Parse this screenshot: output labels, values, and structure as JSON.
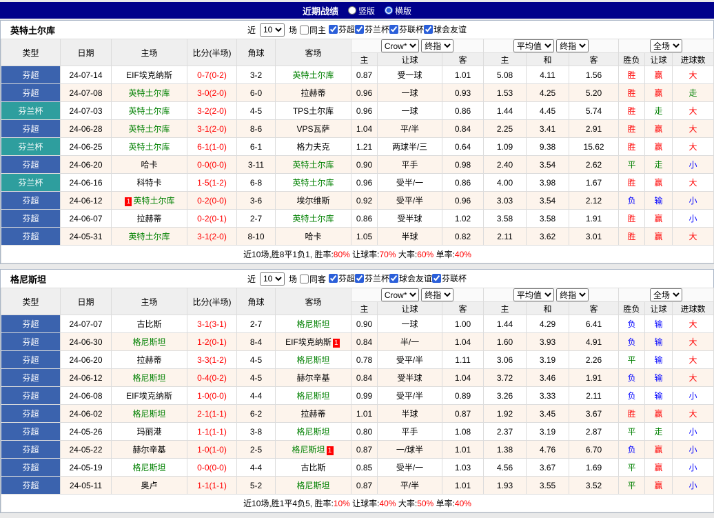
{
  "topbar": {
    "title": "近期战绩",
    "layout_options": [
      {
        "label": "竖版",
        "checked": false
      },
      {
        "label": "横版",
        "checked": true
      }
    ]
  },
  "colors": {
    "topbar_bg": "#00008b",
    "score": "#ff0000",
    "highlight_team": "#008000",
    "badge_bg": "#ff0000",
    "summary_value": "#ff0000",
    "league": {
      "芬超": "#3b63ae",
      "芬兰杯": "#2e9e9e"
    },
    "result": {
      "胜": "#ff0000",
      "平": "#008000",
      "负": "#0000ff",
      "赢": "#ff0000",
      "走": "#008000",
      "输": "#0000ff",
      "大": "#ff0000",
      "小": "#0000ff"
    }
  },
  "sections": [
    {
      "team": "英特土尔库",
      "filter": {
        "prefix": "近",
        "count": "10",
        "suffix": "场",
        "same": {
          "label": "同主",
          "checked": false
        },
        "leagues": [
          {
            "label": "芬超",
            "checked": true
          },
          {
            "label": "芬兰杯",
            "checked": true
          },
          {
            "label": "芬联杯",
            "checked": true
          },
          {
            "label": "球会友谊",
            "checked": true
          }
        ]
      },
      "selects": {
        "book": "Crow*",
        "book_stage": "终指",
        "avg": "平均值",
        "avg_stage": "终指",
        "scope": "全场"
      },
      "columns": {
        "type": "类型",
        "date": "日期",
        "home": "主场",
        "score": "比分(半场)",
        "corner": "角球",
        "away": "客场",
        "ah_home": "主",
        "ah_line": "让球",
        "ah_away": "客",
        "eu_home": "主",
        "eu_draw": "和",
        "eu_away": "客",
        "res_wdl": "胜负",
        "res_ah": "让球",
        "res_goal": "进球数"
      },
      "rows": [
        {
          "league": "芬超",
          "date": "24-07-14",
          "home": {
            "name": "EIF埃克纳斯",
            "hl": false
          },
          "score": "0-7(0-2)",
          "corner": "3-2",
          "away": {
            "name": "英特土尔库",
            "hl": true
          },
          "ah": [
            "0.87",
            "受一球",
            "1.01"
          ],
          "eu": [
            "5.08",
            "4.11",
            "1.56"
          ],
          "results": [
            "胜",
            "赢",
            "大"
          ]
        },
        {
          "league": "芬超",
          "date": "24-07-08",
          "home": {
            "name": "英特土尔库",
            "hl": true
          },
          "score": "3-0(2-0)",
          "corner": "6-0",
          "away": {
            "name": "拉赫蒂",
            "hl": false
          },
          "ah": [
            "0.96",
            "一球",
            "0.93"
          ],
          "eu": [
            "1.53",
            "4.25",
            "5.20"
          ],
          "results": [
            "胜",
            "赢",
            "走"
          ]
        },
        {
          "league": "芬兰杯",
          "date": "24-07-03",
          "home": {
            "name": "英特土尔库",
            "hl": true
          },
          "score": "3-2(2-0)",
          "corner": "4-5",
          "away": {
            "name": "TPS土尔库",
            "hl": false
          },
          "ah": [
            "0.96",
            "一球",
            "0.86"
          ],
          "eu": [
            "1.44",
            "4.45",
            "5.74"
          ],
          "results": [
            "胜",
            "走",
            "大"
          ]
        },
        {
          "league": "芬超",
          "date": "24-06-28",
          "home": {
            "name": "英特土尔库",
            "hl": true
          },
          "score": "3-1(2-0)",
          "corner": "8-6",
          "away": {
            "name": "VPS瓦萨",
            "hl": false
          },
          "ah": [
            "1.04",
            "平/半",
            "0.84"
          ],
          "eu": [
            "2.25",
            "3.41",
            "2.91"
          ],
          "results": [
            "胜",
            "赢",
            "大"
          ]
        },
        {
          "league": "芬兰杯",
          "date": "24-06-25",
          "home": {
            "name": "英特土尔库",
            "hl": true
          },
          "score": "6-1(1-0)",
          "corner": "6-1",
          "away": {
            "name": "格力夫克",
            "hl": false
          },
          "ah": [
            "1.21",
            "两球半/三",
            "0.64"
          ],
          "eu": [
            "1.09",
            "9.38",
            "15.62"
          ],
          "results": [
            "胜",
            "赢",
            "大"
          ]
        },
        {
          "league": "芬超",
          "date": "24-06-20",
          "home": {
            "name": "哈卡",
            "hl": false
          },
          "score": "0-0(0-0)",
          "corner": "3-11",
          "away": {
            "name": "英特土尔库",
            "hl": true
          },
          "ah": [
            "0.90",
            "平手",
            "0.98"
          ],
          "eu": [
            "2.40",
            "3.54",
            "2.62"
          ],
          "results": [
            "平",
            "走",
            "小"
          ]
        },
        {
          "league": "芬兰杯",
          "date": "24-06-16",
          "home": {
            "name": "科特卡",
            "hl": false
          },
          "score": "1-5(1-2)",
          "corner": "6-8",
          "away": {
            "name": "英特土尔库",
            "hl": true
          },
          "ah": [
            "0.96",
            "受半/一",
            "0.86"
          ],
          "eu": [
            "4.00",
            "3.98",
            "1.67"
          ],
          "results": [
            "胜",
            "赢",
            "大"
          ]
        },
        {
          "league": "芬超",
          "date": "24-06-12",
          "home": {
            "name": "英特土尔库",
            "hl": true,
            "badge": "1",
            "badge_side": "left"
          },
          "score": "0-2(0-0)",
          "corner": "3-6",
          "away": {
            "name": "埃尔维斯",
            "hl": false
          },
          "ah": [
            "0.92",
            "受平/半",
            "0.96"
          ],
          "eu": [
            "3.03",
            "3.54",
            "2.12"
          ],
          "results": [
            "负",
            "输",
            "小"
          ]
        },
        {
          "league": "芬超",
          "date": "24-06-07",
          "home": {
            "name": "拉赫蒂",
            "hl": false
          },
          "score": "0-2(0-1)",
          "corner": "2-7",
          "away": {
            "name": "英特土尔库",
            "hl": true
          },
          "ah": [
            "0.86",
            "受半球",
            "1.02"
          ],
          "eu": [
            "3.58",
            "3.58",
            "1.91"
          ],
          "results": [
            "胜",
            "赢",
            "小"
          ]
        },
        {
          "league": "芬超",
          "date": "24-05-31",
          "home": {
            "name": "英特土尔库",
            "hl": true
          },
          "score": "3-1(2-0)",
          "corner": "8-10",
          "away": {
            "name": "哈卡",
            "hl": false
          },
          "ah": [
            "1.05",
            "半球",
            "0.82"
          ],
          "eu": [
            "2.11",
            "3.62",
            "3.01"
          ],
          "results": [
            "胜",
            "赢",
            "大"
          ]
        }
      ],
      "summary": {
        "prefix": "近10场,胜8平1负1,",
        "stats": [
          {
            "label": "胜率:",
            "value": "80%"
          },
          {
            "label": "让球率:",
            "value": "70%"
          },
          {
            "label": "大率:",
            "value": "60%"
          },
          {
            "label": "单率:",
            "value": "40%"
          }
        ]
      }
    },
    {
      "team": "格尼斯坦",
      "filter": {
        "prefix": "近",
        "count": "10",
        "suffix": "场",
        "same": {
          "label": "同客",
          "checked": false
        },
        "leagues": [
          {
            "label": "芬超",
            "checked": true
          },
          {
            "label": "芬兰杯",
            "checked": true
          },
          {
            "label": "球会友谊",
            "checked": true
          },
          {
            "label": "芬联杯",
            "checked": true
          }
        ]
      },
      "selects": {
        "book": "Crow*",
        "book_stage": "终指",
        "avg": "平均值",
        "avg_stage": "终指",
        "scope": "全场"
      },
      "columns": {
        "type": "类型",
        "date": "日期",
        "home": "主场",
        "score": "比分(半场)",
        "corner": "角球",
        "away": "客场",
        "ah_home": "主",
        "ah_line": "让球",
        "ah_away": "客",
        "eu_home": "主",
        "eu_draw": "和",
        "eu_away": "客",
        "res_wdl": "胜负",
        "res_ah": "让球",
        "res_goal": "进球数"
      },
      "rows": [
        {
          "league": "芬超",
          "date": "24-07-07",
          "home": {
            "name": "古比斯",
            "hl": false
          },
          "score": "3-1(3-1)",
          "corner": "2-7",
          "away": {
            "name": "格尼斯坦",
            "hl": true
          },
          "ah": [
            "0.90",
            "一球",
            "1.00"
          ],
          "eu": [
            "1.44",
            "4.29",
            "6.41"
          ],
          "results": [
            "负",
            "输",
            "大"
          ]
        },
        {
          "league": "芬超",
          "date": "24-06-30",
          "home": {
            "name": "格尼斯坦",
            "hl": true
          },
          "score": "1-2(0-1)",
          "corner": "8-4",
          "away": {
            "name": "EIF埃克纳斯",
            "hl": false,
            "badge": "1",
            "badge_side": "right"
          },
          "ah": [
            "0.84",
            "半/一",
            "1.04"
          ],
          "eu": [
            "1.60",
            "3.93",
            "4.91"
          ],
          "results": [
            "负",
            "输",
            "大"
          ]
        },
        {
          "league": "芬超",
          "date": "24-06-20",
          "home": {
            "name": "拉赫蒂",
            "hl": false
          },
          "score": "3-3(1-2)",
          "corner": "4-5",
          "away": {
            "name": "格尼斯坦",
            "hl": true
          },
          "ah": [
            "0.78",
            "受平/半",
            "1.11"
          ],
          "eu": [
            "3.06",
            "3.19",
            "2.26"
          ],
          "results": [
            "平",
            "输",
            "大"
          ]
        },
        {
          "league": "芬超",
          "date": "24-06-12",
          "home": {
            "name": "格尼斯坦",
            "hl": true
          },
          "score": "0-4(0-2)",
          "corner": "4-5",
          "away": {
            "name": "赫尔辛基",
            "hl": false
          },
          "ah": [
            "0.84",
            "受半球",
            "1.04"
          ],
          "eu": [
            "3.72",
            "3.46",
            "1.91"
          ],
          "results": [
            "负",
            "输",
            "大"
          ]
        },
        {
          "league": "芬超",
          "date": "24-06-08",
          "home": {
            "name": "EIF埃克纳斯",
            "hl": false
          },
          "score": "1-0(0-0)",
          "corner": "4-4",
          "away": {
            "name": "格尼斯坦",
            "hl": true
          },
          "ah": [
            "0.99",
            "受平/半",
            "0.89"
          ],
          "eu": [
            "3.26",
            "3.33",
            "2.11"
          ],
          "results": [
            "负",
            "输",
            "小"
          ]
        },
        {
          "league": "芬超",
          "date": "24-06-02",
          "home": {
            "name": "格尼斯坦",
            "hl": true
          },
          "score": "2-1(1-1)",
          "corner": "6-2",
          "away": {
            "name": "拉赫蒂",
            "hl": false
          },
          "ah": [
            "1.01",
            "半球",
            "0.87"
          ],
          "eu": [
            "1.92",
            "3.45",
            "3.67"
          ],
          "results": [
            "胜",
            "赢",
            "大"
          ]
        },
        {
          "league": "芬超",
          "date": "24-05-26",
          "home": {
            "name": "玛丽港",
            "hl": false
          },
          "score": "1-1(1-1)",
          "corner": "3-8",
          "away": {
            "name": "格尼斯坦",
            "hl": true
          },
          "ah": [
            "0.80",
            "平手",
            "1.08"
          ],
          "eu": [
            "2.37",
            "3.19",
            "2.87"
          ],
          "results": [
            "平",
            "走",
            "小"
          ]
        },
        {
          "league": "芬超",
          "date": "24-05-22",
          "home": {
            "name": "赫尔辛基",
            "hl": false
          },
          "score": "1-0(1-0)",
          "corner": "2-5",
          "away": {
            "name": "格尼斯坦",
            "hl": true,
            "badge": "1",
            "badge_side": "right"
          },
          "ah": [
            "0.87",
            "一/球半",
            "1.01"
          ],
          "eu": [
            "1.38",
            "4.76",
            "6.70"
          ],
          "results": [
            "负",
            "赢",
            "小"
          ]
        },
        {
          "league": "芬超",
          "date": "24-05-19",
          "home": {
            "name": "格尼斯坦",
            "hl": true
          },
          "score": "0-0(0-0)",
          "corner": "4-4",
          "away": {
            "name": "古比斯",
            "hl": false
          },
          "ah": [
            "0.85",
            "受半/一",
            "1.03"
          ],
          "eu": [
            "4.56",
            "3.67",
            "1.69"
          ],
          "results": [
            "平",
            "赢",
            "小"
          ]
        },
        {
          "league": "芬超",
          "date": "24-05-11",
          "home": {
            "name": "奥卢",
            "hl": false
          },
          "score": "1-1(1-1)",
          "corner": "5-2",
          "away": {
            "name": "格尼斯坦",
            "hl": true
          },
          "ah": [
            "0.87",
            "平/半",
            "1.01"
          ],
          "eu": [
            "1.93",
            "3.55",
            "3.52"
          ],
          "results": [
            "平",
            "赢",
            "小"
          ]
        }
      ],
      "summary": {
        "prefix": "近10场,胜1平4负5,",
        "stats": [
          {
            "label": "胜率:",
            "value": "10%"
          },
          {
            "label": "让球率:",
            "value": "40%"
          },
          {
            "label": "大率:",
            "value": "50%"
          },
          {
            "label": "单率:",
            "value": "40%"
          }
        ]
      }
    }
  ]
}
